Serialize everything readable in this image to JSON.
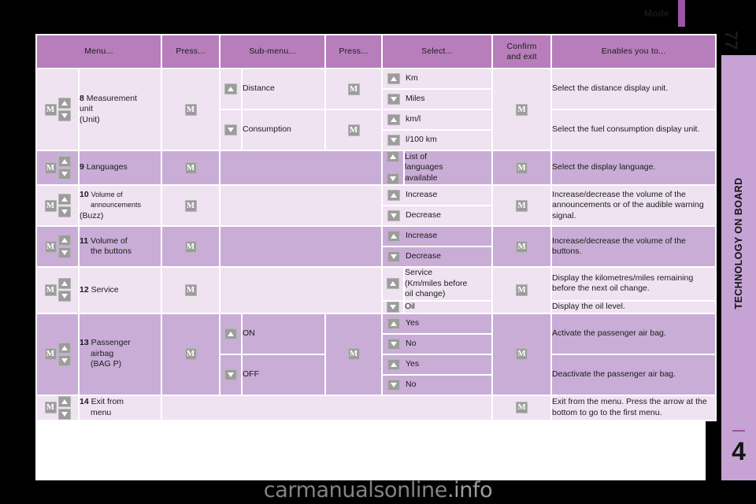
{
  "page": {
    "mode_label": "Mode",
    "page_number": "77",
    "chapter_title": "TECHNOLOGY ON BOARD",
    "chapter_number": "4",
    "watermark": "carmanualsonline",
    "watermark_suffix": ".info"
  },
  "colors": {
    "header_purple": "#B77EBB",
    "row_dark": "#C9ADD6",
    "row_light": "#EFE2F1",
    "key_grey": "#9C9C9C",
    "accent": "#9B54A6"
  },
  "icons": {
    "m_key": "M",
    "arrow_up": "up-arrow-key",
    "arrow_down": "down-arrow-key"
  },
  "table": {
    "headers": [
      "Menu...",
      "Press...",
      "Sub-menu...",
      "Press...",
      "Select...",
      "Confirm and exit",
      "Enables you to..."
    ],
    "header_confirm_line1": "Confirm",
    "header_confirm_line2": "and exit",
    "rows": [
      {
        "num": "8",
        "menu": "Measurement unit (Unit)",
        "menu_lines": [
          "Measurement",
          "unit",
          "(Unit)"
        ],
        "press1": "M",
        "tone": "light",
        "submenus": [
          {
            "label": "Distance",
            "press2": "M",
            "selects": [
              "Km",
              "Miles"
            ],
            "confirm": "M",
            "enables": "Select the distance display unit."
          },
          {
            "label": "Consumption",
            "press2": "M",
            "selects": [
              "km/l",
              "l/100 km"
            ],
            "confirm": "M",
            "enables": "Select the fuel consumption display unit."
          }
        ]
      },
      {
        "num": "9",
        "menu": "Languages",
        "menu_lines": [
          "Languages"
        ],
        "press1": "M",
        "tone": "dark",
        "submenus": [
          {
            "label": "",
            "press2": "",
            "selects": [
              "List of languages available"
            ],
            "select_lines": [
              "List of",
              "languages",
              "available"
            ],
            "confirm": "M",
            "enables": "Select the display language."
          }
        ]
      },
      {
        "num": "10",
        "menu": "Volume of announcements (Buzz)",
        "menu_lines": [
          "Volume of",
          "announcements",
          "(Buzz)"
        ],
        "press1": "M",
        "tone": "light",
        "submenus": [
          {
            "label": "",
            "press2": "",
            "selects": [
              "Increase",
              "Decrease"
            ],
            "confirm": "M",
            "enables": "Increase/decrease the volume of the announcements or of the audible warning signal."
          }
        ]
      },
      {
        "num": "11",
        "menu": "Volume of the buttons",
        "menu_lines": [
          "Volume of",
          "the buttons"
        ],
        "press1": "M",
        "tone": "dark",
        "submenus": [
          {
            "label": "",
            "press2": "",
            "selects": [
              "Increase",
              "Decrease"
            ],
            "confirm": "M",
            "enables": "Increase/decrease the volume of the buttons."
          }
        ]
      },
      {
        "num": "12",
        "menu": "Service",
        "menu_lines": [
          "Service"
        ],
        "press1": "M",
        "tone": "light",
        "submenus": [
          {
            "label": "",
            "press2": "",
            "selects": [
              "Service (Km/miles before oil change)",
              "Oil"
            ],
            "select_lines_0": [
              "Service",
              "(Km/miles before",
              "oil change)"
            ],
            "confirm": "M",
            "enables_0": "Display the kilometres/miles remaining before the next oil change.",
            "enables_1": "Display the oil level."
          }
        ]
      },
      {
        "num": "13",
        "menu": "Passenger airbag (BAG P)",
        "menu_lines": [
          "Passenger",
          "airbag",
          "(BAG P)"
        ],
        "press1": "M",
        "tone": "dark",
        "submenus": [
          {
            "label": "ON",
            "press2": "M",
            "selects": [
              "Yes",
              "No"
            ],
            "confirm": "M",
            "enables": "Activate the passenger air bag."
          },
          {
            "label": "OFF",
            "press2": "",
            "selects": [
              "Yes",
              "No"
            ],
            "confirm": "",
            "enables": "Deactivate the passenger air bag."
          }
        ]
      },
      {
        "num": "14",
        "menu": "Exit from menu",
        "menu_lines": [
          "Exit from",
          "menu"
        ],
        "press1": "",
        "tone": "light",
        "submenus": [
          {
            "label": "",
            "press2": "",
            "selects": [],
            "confirm": "M",
            "enables": "Exit from the menu. Press the arrow at the bottom to go to the first menu."
          }
        ]
      }
    ]
  }
}
